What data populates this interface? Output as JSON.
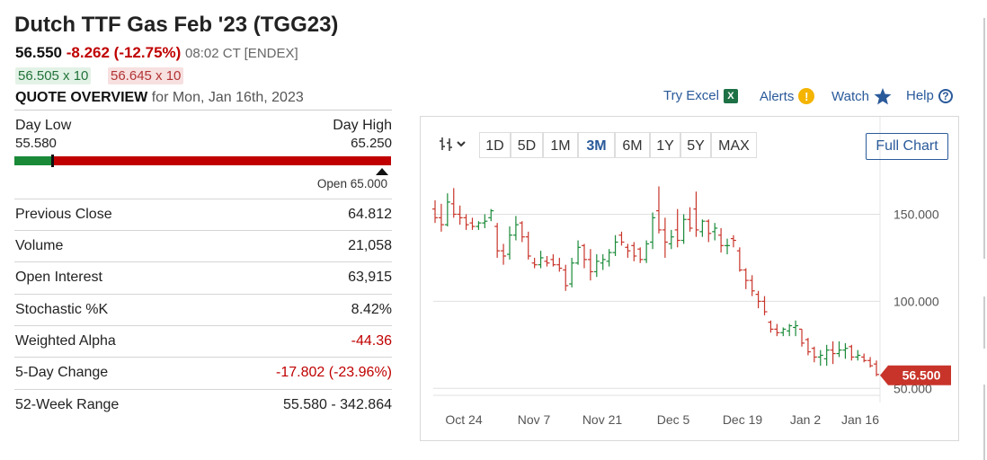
{
  "header": {
    "title": "Dutch TTF Gas Feb '23 (TGG23)",
    "last": "56.550",
    "change": "-8.262 (-12.75%)",
    "time": "08:02 CT [ENDEX]",
    "bid": "56.505 x 10",
    "ask": "56.645 x 10"
  },
  "quote_overview": {
    "label": "QUOTE OVERVIEW",
    "date": "for Mon, Jan 16th, 2023"
  },
  "links": {
    "try_excel": "Try Excel",
    "alerts": "Alerts",
    "watch": "Watch",
    "help": "Help"
  },
  "day_range": {
    "low_label": "Day Low",
    "low_value": "55.580",
    "high_label": "Day High",
    "high_value": "65.250",
    "open": "Open 65.000",
    "last_fraction": 0.1
  },
  "stats": [
    {
      "label": "Previous Close",
      "value": "64.812",
      "negative": false
    },
    {
      "label": "Volume",
      "value": "21,058",
      "negative": false
    },
    {
      "label": "Open Interest",
      "value": "63,915",
      "negative": false
    },
    {
      "label": "Stochastic %K",
      "value": "8.42%",
      "negative": false
    },
    {
      "label": "Weighted Alpha",
      "value": "-44.36",
      "negative": true
    },
    {
      "label": "5-Day Change",
      "value": "-17.802 (-23.96%)",
      "negative": true
    },
    {
      "label": "52-Week Range",
      "value": "55.580 - 342.864",
      "negative": false
    }
  ],
  "chart_toolbar": {
    "tool_icon": "candlestick-chart-icon",
    "ranges": [
      "1D",
      "5D",
      "1M",
      "3M",
      "6M",
      "1Y",
      "5Y",
      "MAX"
    ],
    "active_range": "3M",
    "full_chart": "Full Chart"
  },
  "colors": {
    "up": "#1a8a38",
    "down": "#c8342a",
    "accent": "#2a5a9a",
    "negative": "#c00000"
  },
  "chart_data": {
    "type": "candlestick",
    "x_tick_labels": [
      "Oct 24",
      "Nov 7",
      "Nov 21",
      "Dec 5",
      "Dec 19",
      "Jan 2",
      "Jan 16"
    ],
    "y_tick_labels": [
      "150.000",
      "100.000",
      "50.000"
    ],
    "y_ticks": [
      150,
      100,
      50
    ],
    "ylim": [
      45,
      175
    ],
    "last_price_label": "56.500",
    "last_price": 56.5,
    "grid": true,
    "candles": [
      {
        "o": 153,
        "h": 158,
        "l": 145,
        "c": 148
      },
      {
        "o": 148,
        "h": 156,
        "l": 140,
        "c": 144
      },
      {
        "o": 144,
        "h": 162,
        "l": 143,
        "c": 157
      },
      {
        "o": 156,
        "h": 165,
        "l": 148,
        "c": 150
      },
      {
        "o": 150,
        "h": 155,
        "l": 144,
        "c": 148
      },
      {
        "o": 148,
        "h": 150,
        "l": 141,
        "c": 144
      },
      {
        "o": 145,
        "h": 148,
        "l": 141,
        "c": 143
      },
      {
        "o": 143,
        "h": 146,
        "l": 141,
        "c": 145
      },
      {
        "o": 145,
        "h": 150,
        "l": 142,
        "c": 146
      },
      {
        "o": 148,
        "h": 153,
        "l": 146,
        "c": 152
      },
      {
        "o": 143,
        "h": 145,
        "l": 125,
        "c": 129
      },
      {
        "o": 129,
        "h": 133,
        "l": 121,
        "c": 126
      },
      {
        "o": 127,
        "h": 143,
        "l": 124,
        "c": 138
      },
      {
        "o": 138,
        "h": 149,
        "l": 135,
        "c": 144
      },
      {
        "o": 145,
        "h": 146,
        "l": 134,
        "c": 137
      },
      {
        "o": 137,
        "h": 140,
        "l": 124,
        "c": 126
      },
      {
        "o": 122,
        "h": 125,
        "l": 119,
        "c": 121
      },
      {
        "o": 121,
        "h": 129,
        "l": 119,
        "c": 125
      },
      {
        "o": 123,
        "h": 126,
        "l": 120,
        "c": 122
      },
      {
        "o": 124,
        "h": 127,
        "l": 120,
        "c": 121
      },
      {
        "o": 121,
        "h": 125,
        "l": 117,
        "c": 119
      },
      {
        "o": 118,
        "h": 121,
        "l": 106,
        "c": 109
      },
      {
        "o": 110,
        "h": 125,
        "l": 108,
        "c": 122
      },
      {
        "o": 122,
        "h": 135,
        "l": 121,
        "c": 131
      },
      {
        "o": 132,
        "h": 133,
        "l": 119,
        "c": 124
      },
      {
        "o": 124,
        "h": 130,
        "l": 112,
        "c": 117
      },
      {
        "o": 117,
        "h": 127,
        "l": 114,
        "c": 123
      },
      {
        "o": 122,
        "h": 127,
        "l": 118,
        "c": 124
      },
      {
        "o": 123,
        "h": 130,
        "l": 120,
        "c": 128
      },
      {
        "o": 128,
        "h": 138,
        "l": 126,
        "c": 134
      },
      {
        "o": 138,
        "h": 140,
        "l": 132,
        "c": 134
      },
      {
        "o": 131,
        "h": 133,
        "l": 125,
        "c": 129
      },
      {
        "o": 132,
        "h": 134,
        "l": 123,
        "c": 126
      },
      {
        "o": 130,
        "h": 131,
        "l": 122,
        "c": 124
      },
      {
        "o": 124,
        "h": 135,
        "l": 122,
        "c": 133
      },
      {
        "o": 134,
        "h": 151,
        "l": 130,
        "c": 148
      },
      {
        "o": 152,
        "h": 166,
        "l": 139,
        "c": 141
      },
      {
        "o": 141,
        "h": 148,
        "l": 125,
        "c": 134
      },
      {
        "o": 133,
        "h": 141,
        "l": 130,
        "c": 137
      },
      {
        "o": 141,
        "h": 153,
        "l": 131,
        "c": 135
      },
      {
        "o": 135,
        "h": 150,
        "l": 133,
        "c": 147
      },
      {
        "o": 147,
        "h": 154,
        "l": 140,
        "c": 142
      },
      {
        "o": 153,
        "h": 163,
        "l": 137,
        "c": 141
      },
      {
        "o": 140,
        "h": 147,
        "l": 137,
        "c": 146
      },
      {
        "o": 146,
        "h": 147,
        "l": 134,
        "c": 139
      },
      {
        "o": 140,
        "h": 145,
        "l": 135,
        "c": 142
      },
      {
        "o": 138,
        "h": 142,
        "l": 128,
        "c": 132
      },
      {
        "o": 132,
        "h": 136,
        "l": 127,
        "c": 132
      },
      {
        "o": 136,
        "h": 138,
        "l": 131,
        "c": 135
      },
      {
        "o": 129,
        "h": 131,
        "l": 117,
        "c": 118
      },
      {
        "o": 118,
        "h": 119,
        "l": 107,
        "c": 112
      },
      {
        "o": 112,
        "h": 115,
        "l": 103,
        "c": 106
      },
      {
        "o": 104,
        "h": 106,
        "l": 96,
        "c": 100
      },
      {
        "o": 100,
        "h": 103,
        "l": 92,
        "c": 94
      },
      {
        "o": 88,
        "h": 89,
        "l": 82,
        "c": 84
      },
      {
        "o": 84,
        "h": 87,
        "l": 80,
        "c": 82
      },
      {
        "o": 82,
        "h": 85,
        "l": 80,
        "c": 84
      },
      {
        "o": 83,
        "h": 87,
        "l": 80,
        "c": 86
      },
      {
        "o": 85,
        "h": 89,
        "l": 80,
        "c": 86
      },
      {
        "o": 84,
        "h": 84,
        "l": 74,
        "c": 76
      },
      {
        "o": 78,
        "h": 79,
        "l": 69,
        "c": 71
      },
      {
        "o": 73,
        "h": 74,
        "l": 65,
        "c": 68
      },
      {
        "o": 68,
        "h": 72,
        "l": 63,
        "c": 69
      },
      {
        "o": 67,
        "h": 75,
        "l": 63,
        "c": 72
      },
      {
        "o": 72,
        "h": 77,
        "l": 64,
        "c": 70
      },
      {
        "o": 70,
        "h": 77,
        "l": 68,
        "c": 72
      },
      {
        "o": 72,
        "h": 76,
        "l": 67,
        "c": 73
      },
      {
        "o": 74,
        "h": 75,
        "l": 66,
        "c": 68
      },
      {
        "o": 68,
        "h": 72,
        "l": 66,
        "c": 69
      },
      {
        "o": 68,
        "h": 70,
        "l": 65,
        "c": 66
      },
      {
        "o": 66,
        "h": 68,
        "l": 62,
        "c": 63
      },
      {
        "o": 64,
        "h": 66,
        "l": 57,
        "c": 58
      }
    ]
  }
}
